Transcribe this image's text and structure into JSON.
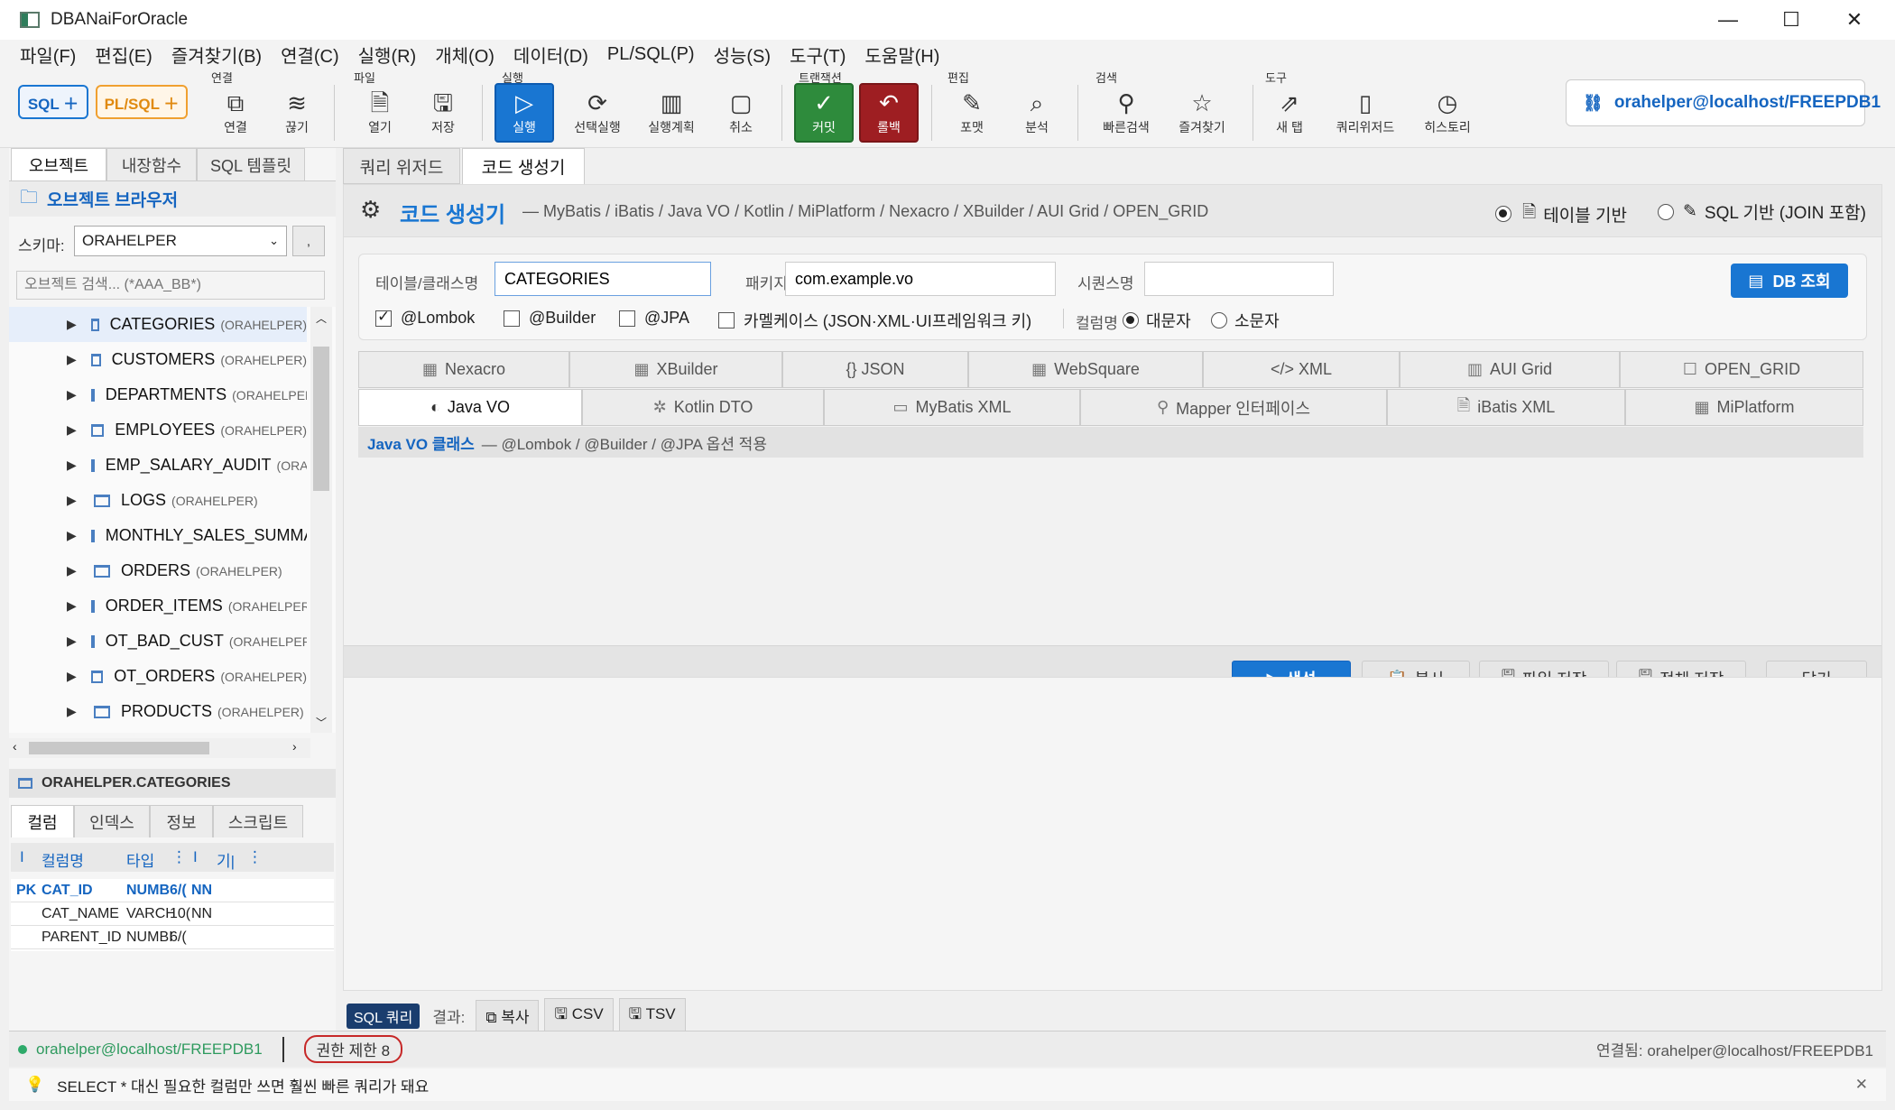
{
  "window": {
    "title": "DBANaiForOracle",
    "minimize": "—",
    "maximize": "☐",
    "close": "✕"
  },
  "menu": [
    "파일(F)",
    "편집(E)",
    "즐겨찾기(B)",
    "연결(C)",
    "실행(R)",
    "개체(O)",
    "데이터(D)",
    "PL/SQL(P)",
    "성능(S)",
    "도구(T)",
    "도움말(H)"
  ],
  "toolbar": {
    "sql_btn": "SQL ＋",
    "plsql_btn": "PL/SQL ＋",
    "groups": {
      "conn": "연결",
      "file": "파일",
      "run": "실행",
      "tx": "트랜잭션",
      "edit": "편집",
      "search": "검색",
      "tools": "도구"
    },
    "connect": "연결",
    "disconnect": "끊기",
    "open": "열기",
    "save": "저장",
    "run": "실행",
    "run_selected": "선택실행",
    "plan": "실행계획",
    "cancel": "취소",
    "commit": "커밋",
    "rollback": "롤백",
    "format": "포맷",
    "analyze": "분석",
    "quick_search": "빠른검색",
    "favorites": "즐겨찾기",
    "new_tab": "새 탭",
    "query_wizard": "쿼리위저드",
    "history": "히스토리",
    "connection": "orahelper@localhost/FREEPDB1"
  },
  "left": {
    "tabs": [
      "오브젝트",
      "내장함수",
      "SQL 템플릿"
    ],
    "browser_title": "오브젝트 브라우저",
    "schema_label": "스키마:",
    "schema_value": "ORAHELPER",
    "schema_btn": ",",
    "search_placeholder": "오브젝트 검색... (*AAA_BB*)",
    "tree": [
      {
        "name": "CATEGORIES",
        "schema": "(ORAHELPER)"
      },
      {
        "name": "CUSTOMERS",
        "schema": "(ORAHELPER)"
      },
      {
        "name": "DEPARTMENTS",
        "schema": "(ORAHELPEF"
      },
      {
        "name": "EMPLOYEES",
        "schema": "(ORAHELPER)"
      },
      {
        "name": "EMP_SALARY_AUDIT",
        "schema": "(ORAI"
      },
      {
        "name": "LOGS",
        "schema": "(ORAHELPER)"
      },
      {
        "name": "MONTHLY_SALES_SUMMA",
        "schema": ""
      },
      {
        "name": "ORDERS",
        "schema": "(ORAHELPER)"
      },
      {
        "name": "ORDER_ITEMS",
        "schema": "(ORAHELPER)"
      },
      {
        "name": "OT_BAD_CUST",
        "schema": "(ORAHELPER"
      },
      {
        "name": "OT_ORDERS",
        "schema": "(ORAHELPER)"
      },
      {
        "name": "PRODUCTS",
        "schema": "(ORAHELPER)"
      }
    ],
    "detail_title": "ORAHELPER.CATEGORIES",
    "detail_tabs": [
      "컬럼",
      "인덱스",
      "정보",
      "스크립트"
    ],
    "col_headers": [
      "I",
      "컬럼명",
      "타입",
      "⋮",
      "I",
      "기|",
      "⋮"
    ],
    "rows": [
      {
        "k": "PK",
        "name": "CAT_ID",
        "type": "NUMB",
        "size": "6/(",
        "nn": "NN"
      },
      {
        "k": "",
        "name": "CAT_NAME",
        "type": "VARCH",
        "size": "10(",
        "nn": "NN"
      },
      {
        "k": "",
        "name": "PARENT_ID",
        "type": "NUMBI",
        "size": "6/(",
        "nn": ""
      }
    ]
  },
  "main": {
    "tabs": [
      "쿼리 위저드",
      "코드 생성기"
    ],
    "header_title": "코드 생성기",
    "header_sub": "— MyBatis / iBatis / Java VO / Kotlin / MiPlatform / Nexacro / XBuilder / AUI Grid / OPEN_GRID",
    "mode_table": "테이블 기반",
    "mode_sql": "SQL 기반 (JOIN 포함)",
    "table_label": "테이블/클래스명",
    "table_value": "CATEGORIES",
    "package_label": "패키지",
    "package_value": "com.example.vo",
    "sequence_label": "시퀀스명",
    "sequence_value": "",
    "db_btn": "DB 조회",
    "opt_lombok": "@Lombok",
    "opt_builder": "@Builder",
    "opt_jpa": "@JPA",
    "opt_camel": "카멜케이스 (JSON·XML·UI프레임워크 키)",
    "colname_label": "컬럼명",
    "upper": "대문자",
    "lower": "소문자",
    "formats_row1": [
      "Nexacro",
      "XBuilder",
      "{} JSON",
      "WebSquare",
      "</> XML",
      "AUI Grid",
      "OPEN_GRID"
    ],
    "formats_row2": [
      "Java VO",
      "Kotlin DTO",
      "MyBatis XML",
      "Mapper 인터페이스",
      "iBatis XML",
      "MiPlatform"
    ],
    "desc_title": "Java VO 클래스",
    "desc_text": "— @Lombok / @Builder / @JPA 옵션 적용",
    "btn_generate": "생성",
    "btn_copy": "복사",
    "btn_save_file": "파일 저장",
    "btn_save_all": "전체 저장",
    "btn_close": "닫기",
    "sql_badge": "SQL 쿼리",
    "result_label": "결과:",
    "res_copy": "복사",
    "res_csv": "CSV",
    "res_tsv": "TSV"
  },
  "status": {
    "conn": "orahelper@localhost/FREEPDB1",
    "perm": "권한 제한 8",
    "connected": "연결됨: orahelper@localhost/FREEPDB1",
    "tip": "SELECT * 대신 필요한 컬럼만 쓰면 훨씬 빠른 쿼리가 돼요",
    "tip_close": "✕"
  },
  "colors": {
    "accent": "#1976d2",
    "commit": "#2e8b3c",
    "rollback": "#9e1e22",
    "plsql": "#f0a030"
  }
}
